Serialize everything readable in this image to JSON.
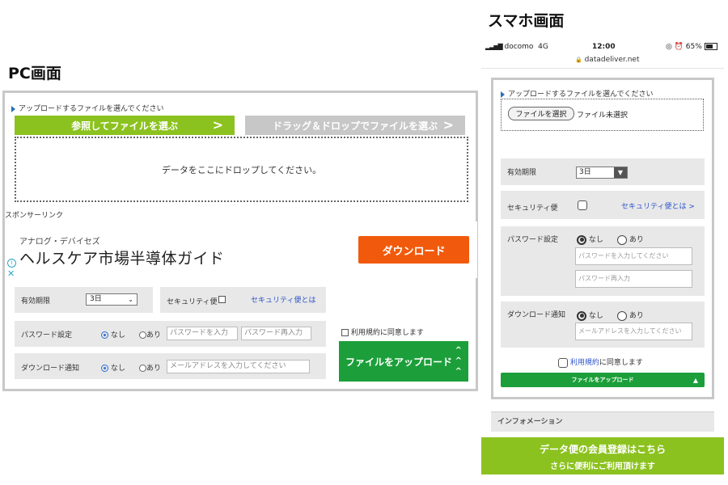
{
  "pc": {
    "heading": "PC画面",
    "select_label": "アップロードするファイルを選んでください",
    "browse_button": "参照してファイルを選ぶ",
    "dragdrop_button": "ドラッグ＆ドロップでファイルを選ぶ",
    "dropzone_text": "データをここにドロップしてください。",
    "sponsor_label": "スポンサーリンク",
    "ad": {
      "advertiser": "アナログ・デバイセズ",
      "title": "ヘルスケア市場半導体ガイド",
      "button": "ダウンロード"
    },
    "expiry": {
      "label": "有効期限",
      "value": "3日"
    },
    "security": {
      "label": "セキュリティ便",
      "link": "セキュリティ便とは"
    },
    "password": {
      "label": "パスワード設定",
      "opt_none": "なし",
      "opt_yes": "あり",
      "placeholder1": "パスワードを入力",
      "placeholder2": "パスワード再入力"
    },
    "notify": {
      "label": "ダウンロード通知",
      "opt_none": "なし",
      "opt_yes": "あり",
      "placeholder": "メールアドレスを入力してください"
    },
    "terms": "利用規約に同意します",
    "upload_button": "ファイルをアップロード"
  },
  "mobile": {
    "heading": "スマホ画面",
    "status": {
      "carrier": "docomo",
      "network": "4G",
      "time": "12:00",
      "url": "datadeliver.net",
      "battery": "65%"
    },
    "select_label": "アップロードするファイルを選んでください",
    "file_button": "ファイルを選択",
    "file_status": "ファイル未選択",
    "expiry": {
      "label": "有効期限",
      "value": "3日"
    },
    "security": {
      "label": "セキュリティ便",
      "link": "セキュリティ便とは >"
    },
    "password": {
      "label": "パスワード設定",
      "opt_none": "なし",
      "opt_yes": "あり",
      "placeholder1": "パスワードを入力してください",
      "placeholder2": "パスワード再入力"
    },
    "notify": {
      "label": "ダウンロード通知",
      "opt_none": "なし",
      "opt_yes": "あり",
      "placeholder": "メールアドレスを入力してください"
    },
    "terms_link": "利用規約",
    "terms_rest": "に同意します",
    "upload_button": "ファイルをアップロード",
    "info_label": "インフォメーション",
    "member_line1": "データ便の会員登録はこちら",
    "member_line2": "さらに便利にご利用頂けます"
  },
  "colors": {
    "green_light": "#8cc21f",
    "green_dark": "#1c9f3a",
    "orange": "#f15a0c",
    "gray_panel": "#e8e8e8",
    "link_blue": "#2d55c9"
  }
}
